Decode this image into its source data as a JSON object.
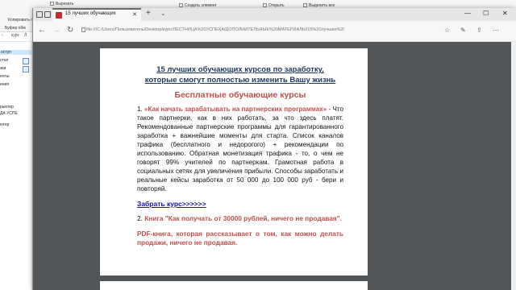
{
  "explorer": {
    "ribbon_items": [
      "Вырезать",
      "Копировать путь",
      "Создать элемент",
      "Открыть",
      "Выделить все"
    ],
    "left_labels": [
      "Буфер обм"
    ],
    "address_fragment": "курс",
    "address_separator": "Л",
    "nav_items": [
      "оступ",
      "стол",
      "зки",
      "енты",
      "ения"
    ],
    "nav_lower": [
      "рьютер",
      "ДА УСПЕ",
      "ютер"
    ],
    "nav_selected": "оступ"
  },
  "browser": {
    "tab_title": "15 лучших обучающих",
    "tab_close": "✕",
    "tab_new": "+",
    "tab_chevron": "⌄",
    "window_controls": [
      "—",
      "☐",
      "✕"
    ],
    "nav": {
      "back": "←",
      "forward": "→",
      "refresh": "↻"
    },
    "url": "file:///C:/Users/Пользователь/Desktop/курс/ЛЕСТНИЦА%20УСПЕХА/ДОПОЛНИТЕЛЬНЫЕ%20МАТЕРИАЛЫ/15%20лучших%20обу",
    "right_icons": [
      "☆",
      "✎",
      "⇪",
      "⋯"
    ]
  },
  "document": {
    "title_line1": "15 лучших  обучающих курсов по заработку,",
    "title_line2": "которые смогут полностью изменить Вашу жизнь",
    "subtitle": "Бесплатные обучающие курсы",
    "item1_number": "1.",
    "item1_title": "«Как начать зарабатывать на партнерских программах»",
    "item1_text": "- Что такое партнерки, как в них работать, за что здесь платят. Рекомендованные партнерские программы для гарантированного заработка + важнейшие моменты для старта. Список каналов трафика (бесплатного и недорогого) + рекомендации по использованию. Обратная монетизация трафика - то, о чем не говорят 99% учителей по партнеркам. Грамотная работа в социальных сетях для увеличения прибыли. Способы заработать и реальные кейсы заработка от 50 000 до 100 000 руб - бери и повторяй.",
    "link": "Забрать курс>>>>>>",
    "item2_number": "2.",
    "item2_title": "Книга \"Как получать от 30000 рублей, ничего не продавая\".",
    "item2_text": "PDF-книга, которая рассказывает о том, как можно делать продажи, ничего не продавая."
  }
}
